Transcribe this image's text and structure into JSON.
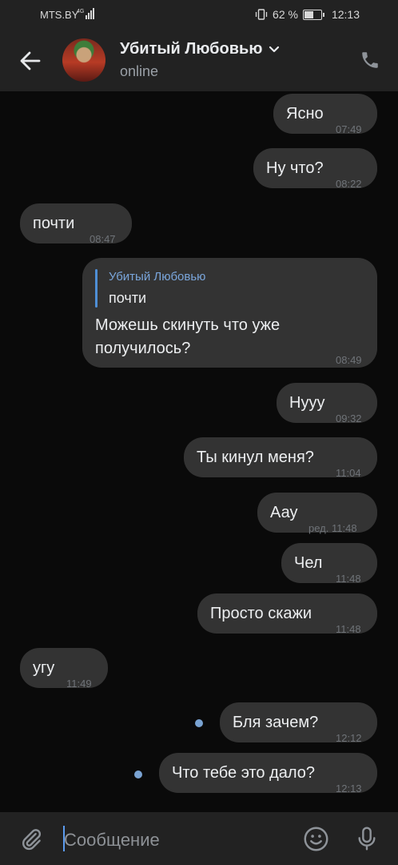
{
  "status_bar": {
    "carrier": "MTS.BY",
    "network": "4G",
    "battery": "62 %",
    "battery_level": 0.62,
    "time": "12:13"
  },
  "header": {
    "title": "Убитый Любовью",
    "status": "online"
  },
  "messages": [
    {
      "dir": "out",
      "text": "Ясно",
      "time": "07:49"
    },
    {
      "dir": "out",
      "text": "Ну что?",
      "time": "08:22"
    },
    {
      "dir": "in",
      "text": "почти",
      "time": "08:47"
    },
    {
      "dir": "out",
      "reply_author": "Убитый Любовью",
      "reply_text": "почти",
      "text_line1": "Можешь скинуть что уже",
      "text_line2": "получилось?",
      "time": "08:49"
    },
    {
      "dir": "out",
      "text": "Нууу",
      "time": "09:32"
    },
    {
      "dir": "out",
      "text": "Ты кинул меня?",
      "time": "11:04"
    },
    {
      "dir": "out",
      "text": "Аау",
      "time": "ред. 11:48"
    },
    {
      "dir": "out",
      "text": "Чел",
      "time": "11:48"
    },
    {
      "dir": "out",
      "text": "Просто скажи",
      "time": "11:48"
    },
    {
      "dir": "in",
      "text": "угу",
      "time": "11:49"
    },
    {
      "dir": "out",
      "text": "Бля зачем?",
      "time": "12:12",
      "unread": true
    },
    {
      "dir": "out",
      "text": "Что тебе это дало?",
      "time": "12:13",
      "unread": true
    }
  ],
  "composer": {
    "placeholder": "Сообщение"
  },
  "icons": {
    "back": "arrow-left-icon",
    "chevron": "chevron-down-icon",
    "call": "phone-icon",
    "attach": "paperclip-icon",
    "emoji": "smile-icon",
    "voice": "microphone-icon"
  },
  "colors": {
    "bubble": "#333333",
    "background": "#0a0a0a",
    "bar": "#222222",
    "accent": "#7aa3d2"
  }
}
